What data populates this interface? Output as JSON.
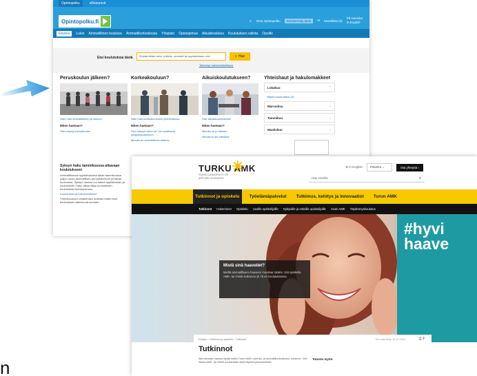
{
  "opintopolku": {
    "topstrip": [
      "Opintopolku",
      "eResurssit"
    ],
    "logo": "Opintopolku.fi",
    "header_right": {
      "oma": "Oma Opintopolku",
      "select": "Rekisteröidy tästä",
      "favorites": "Muistilista (0)",
      "lang": [
        "På svenska",
        "In English"
      ]
    },
    "nav": [
      "Etusivu",
      "Lukio",
      "Ammatillinen koulutus",
      "Ammattikorkeakoulu",
      "Yliopisto",
      "Opistopimus",
      "Aikuiskoulutus",
      "Koulutuksen valinta",
      "Opoille"
    ],
    "search": {
      "label": "Etsi koulutuksia tästä",
      "placeholder": "Kirjoita tähän esim. tutkinto, ammatti tai oppilaitoksen nimi",
      "button": "Hae",
      "advanced": "Tarkempi hakumahdollisuus"
    },
    "columns": [
      {
        "title": "Peruskoulun jälkeen?",
        "link1": "Näin haet ammatilliseen ja lukioon",
        "question": "Miten haetaan?",
        "link2": "Olen käynyt peruskoulun"
      },
      {
        "title": "Korkeakouluun?",
        "link1": "Näin haet korkeakouluihin yhteishaussa",
        "question": "Miten haetaan?",
        "link2": "Olen käynyt lukion ja / tai suorittanut ylioppilastutkinnon",
        "link3": "Minulla on ammatillinen tutkinto"
      },
      {
        "title": "Aikuiskoulutukseen?",
        "link1": "Hae aikuiskoulutukseen",
        "question": "Miten haetaan?",
        "link2": "Minulla on jo tutkinto",
        "link3": "Minulla ei ole tutkintoa"
      }
    ],
    "haut": {
      "title": "Yhteishaut ja hakulomakkeet",
      "items": [
        "Lokakuu",
        "Marraskuu",
        "Tammikuu",
        "Maaliskuu"
      ],
      "more": "Näytä muuta tietoa (3)"
    },
    "story": {
      "title": "Syksyn haku tammikuussa alkavaan koulutukseen",
      "text": "Ammatillisessa oppilaitoksissa alkaa tammikuussa paljon uusia ammatillisen perustutkintoon johtavaa koulutusta. Syksyn haussa voi hakea oppilaitoksiin ja koulutuksiin. Haku alkaa liittyy koulutuksen koulutuksia Opintopolussa.",
      "link": "Koulutukset ja hakulomakkeet",
      "text2": "Yhteishaussa Lomakehaku aukeaa mutta muut koulutukset hakeutuvat suoraan."
    }
  },
  "turku": {
    "brand": "TURKU AMK",
    "brand_sub": [
      "TURKU UNIVERSITY OF",
      "APPLIED SCIENCES"
    ],
    "en": "In English",
    "palvelut": "Palvelut",
    "yhteys": "Ota yhteyttä",
    "search_placeholder": "Hae sivuilta",
    "main_nav": [
      "Tutkinnot ja opiskelu",
      "Työelämäpalvelut",
      "Tutkimus, kehitys ja innovaatiot",
      "Turun AMK"
    ],
    "sub_nav": [
      "Tutkinnot",
      "Hakeminen",
      "Opiskelu",
      "Uusille opiskelijoille",
      "Nykyisille ja entisille opiskelijoille",
      "Avoin AMK",
      "Täydennyskoulutus"
    ],
    "hero": {
      "title": "Mistä sinä haaveilet?",
      "text": "Meiltä ammatilliseen haaveen muutkaa totaksi. Voit opiskella AMK- tai YAMK-tutkinnon yli 70 eri koulutuksessa.",
      "hashtag": [
        "#hyvi",
        "haave"
      ]
    },
    "card": {
      "breadcrumb": "Etusivu › Tutkinnot ja opiskelu › Tutkinnot",
      "updated": "Sivu päivitetty 16.10.2016",
      "title": "Tutkinnot",
      "text": "Alla olevasta haussa löydät kaikki Turun AMK:n ylempi- ja ammattikorkeakoulu- tutkinnot. Voit hakea AMK- tai YAMK-koulutuksiin sekä täydennyskoulutuksiin.",
      "tutustu": "Tutustu myös:"
    }
  },
  "stray_text": "n"
}
